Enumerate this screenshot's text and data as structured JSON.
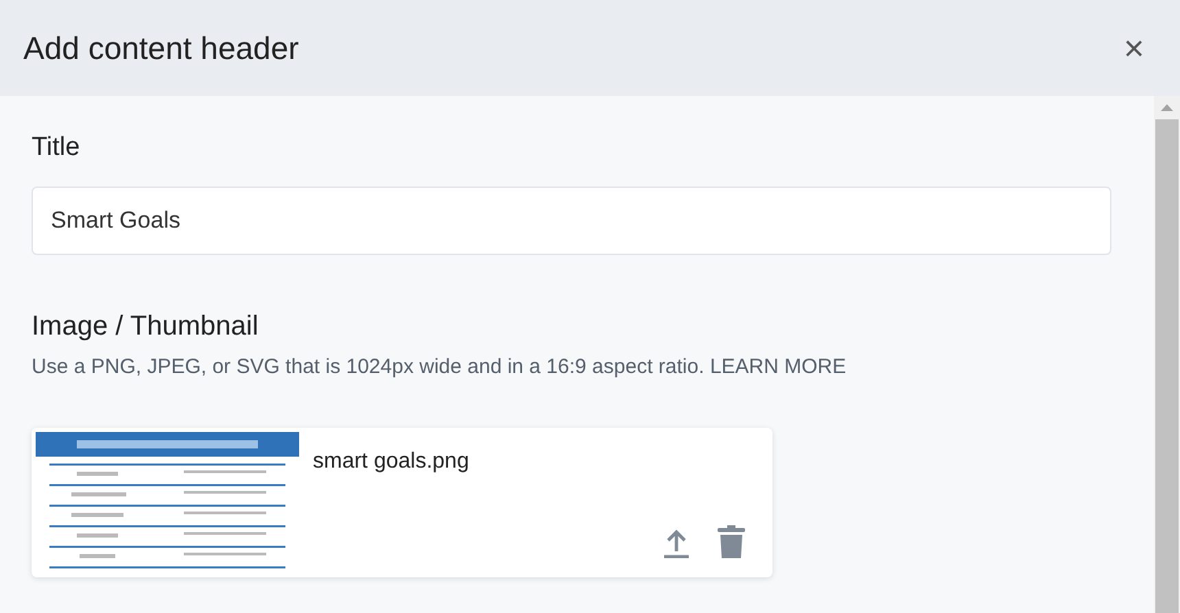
{
  "dialog": {
    "title": "Add content header",
    "close": "×"
  },
  "title_field": {
    "label": "Title",
    "value": "Smart Goals"
  },
  "image_field": {
    "label": "Image / Thumbnail",
    "hint": "Use a PNG, JPEG, or SVG that is 1024px wide and in a 16:9 aspect ratio.",
    "link": "LEARN MORE"
  },
  "file": {
    "name": "smart goals.png"
  }
}
